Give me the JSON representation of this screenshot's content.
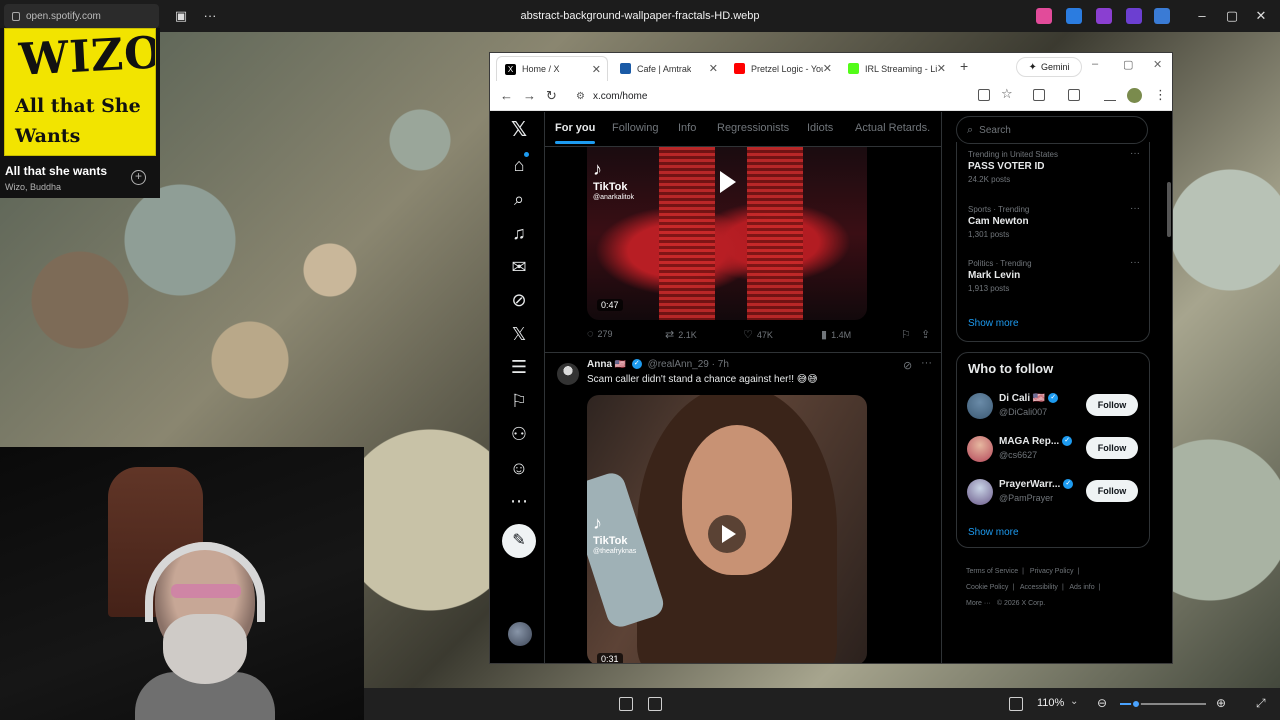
{
  "topbar": {
    "url": "open.spotify.com",
    "window_title": "abstract-background-wallpaper-fractals-HD.webp"
  },
  "spotify": {
    "album_art_text": "WIZO",
    "album_art_subtext": "All that She Wants",
    "track": "All that she wants",
    "artist": "Wizo, Buddha",
    "add_symbol": "+"
  },
  "browser": {
    "tabs": [
      {
        "label": "Home / X",
        "favicon_color": "#000000",
        "active": true
      },
      {
        "label": "Cafe | Amtrak",
        "favicon_color": "#1a5aa6",
        "active": false
      },
      {
        "label": "Pretzel Logic - You",
        "favicon_color": "#ff0000",
        "active": false
      },
      {
        "label": "IRL Streaming - Liv",
        "favicon_color": "#53fc18",
        "active": false
      }
    ],
    "gemini_label": "Gemini",
    "address": "x.com/home"
  },
  "x": {
    "feed_tabs": [
      "For you",
      "Following",
      "Info",
      "Regressionists",
      "Idiots",
      "Actual Retards."
    ],
    "tweet1": {
      "tiktok_label": "TikTok",
      "tiktok_handle": "@anarkalitok",
      "duration": "0:47",
      "replies": "279",
      "reposts": "2.1K",
      "likes": "47K",
      "views": "1.4M"
    },
    "tweet2": {
      "name": "Anna",
      "flag": "🇺🇸",
      "handle_time": "@realAnn_29 · 7h",
      "text": "Scam caller didn't stand a chance against her!! 😅😅",
      "tiktok_label": "TikTok",
      "tiktok_handle": "@theafryknas",
      "duration": "0:31"
    },
    "search_placeholder": "Search",
    "trends": [
      {
        "context": "Trending in United States",
        "title": "PASS VOTER ID",
        "count": "24.2K posts"
      },
      {
        "context": "Sports · Trending",
        "title": "Cam Newton",
        "count": "1,301 posts"
      },
      {
        "context": "Politics · Trending",
        "title": "Mark Levin",
        "count": "1,913 posts"
      }
    ],
    "show_more": "Show more",
    "who_to_follow": {
      "title": "Who to follow",
      "accounts": [
        {
          "name": "Di Cali 🇺🇸",
          "handle": "@DiCali007",
          "button": "Follow"
        },
        {
          "name": "MAGA Rep...",
          "handle": "@cs6627",
          "button": "Follow"
        },
        {
          "name": "PrayerWarr...",
          "handle": "@PamPrayer",
          "button": "Follow"
        }
      ],
      "show_more": "Show more"
    },
    "footer": [
      "Terms of Service",
      "|",
      "Privacy Policy",
      "|",
      "Cookie Policy",
      "|",
      "Accessibility",
      "|",
      "Ads info",
      "|",
      "More ···",
      "© 2026 X Corp."
    ]
  },
  "viewer": {
    "zoom": "110%"
  },
  "colors": {
    "x_blue": "#1d9bf0",
    "x_bg": "#000000",
    "spotify_yellow": "#f2e400"
  }
}
